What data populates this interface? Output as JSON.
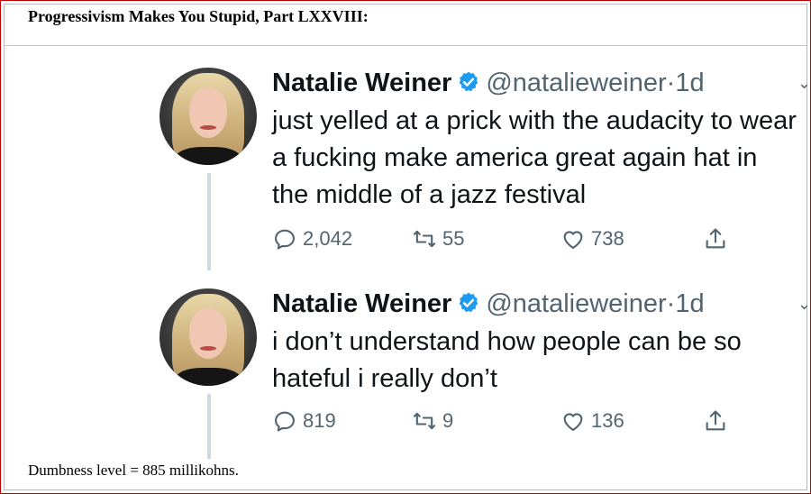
{
  "headline": "Progressivism Makes You Stupid, Part LXXVIII:",
  "footer": "Dumbness level = 885 millikohns.",
  "colors": {
    "verified": "#1d9bf0",
    "secondary_text": "#536471",
    "frame_border": "#c00000"
  },
  "tweets": [
    {
      "name": "Natalie Weiner",
      "handle": "@natalieweiner",
      "separator": "·",
      "time": "1d",
      "text": "just yelled at a prick with the audacity to wear a fucking make america great again hat in the middle of a jazz festival",
      "replies": "2,042",
      "retweets": "55",
      "likes": "738"
    },
    {
      "name": "Natalie Weiner",
      "handle": "@natalieweiner",
      "separator": "·",
      "time": "1d",
      "text": "i don’t understand how people can be so hateful i really don’t",
      "replies": "819",
      "retweets": "9",
      "likes": "136"
    }
  ],
  "icons": [
    "avatar",
    "verified-badge-icon",
    "caret-down-icon",
    "reply-icon",
    "retweet-icon",
    "like-icon",
    "share-icon"
  ]
}
